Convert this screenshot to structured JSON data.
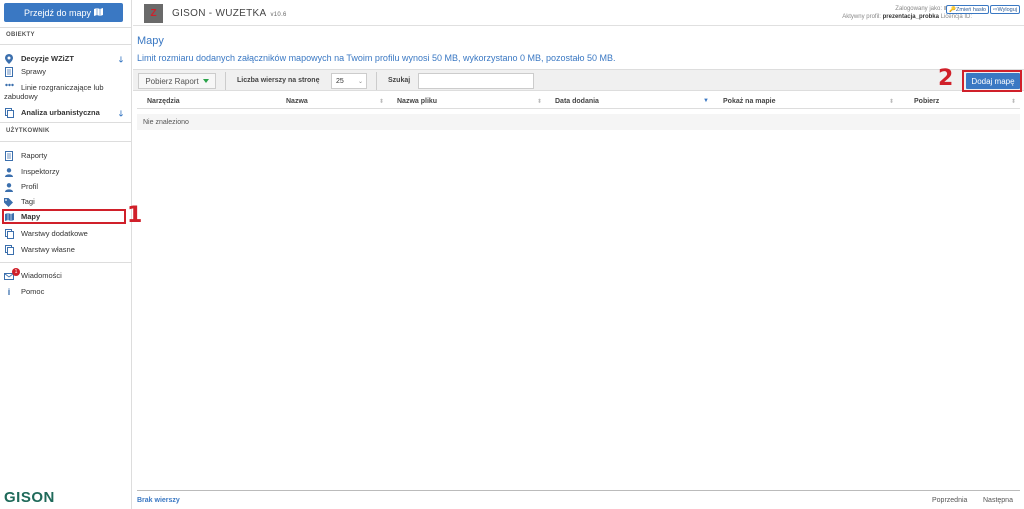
{
  "sidebar": {
    "map_button_label": "Przejdź do mapy",
    "section_objects": "OBIEKTY",
    "section_user": "UŻYTKOWNIK",
    "objects_items": [
      {
        "label": "Decyzje WZiZT",
        "icon": "chevron-down-icon"
      },
      {
        "label": "Sprawy",
        "icon": "document-icon"
      },
      {
        "label": "Linie rozgraniczające lub zabudowy",
        "icon": "dots-icon"
      },
      {
        "label": "Analiza urbanistyczna",
        "icon": "copy-icon"
      }
    ],
    "user_items": [
      {
        "label": "Raporty",
        "icon": "document-icon"
      },
      {
        "label": "Inspektorzy",
        "icon": "user-icon"
      },
      {
        "label": "Profil",
        "icon": "user-icon"
      },
      {
        "label": "Tagi",
        "icon": "tags-icon"
      },
      {
        "label": "Mapy",
        "icon": "map-icon"
      },
      {
        "label": "Warstwy dodatkowe",
        "icon": "layers-icon"
      },
      {
        "label": "Warstwy własne",
        "icon": "layers-icon"
      }
    ],
    "extra_items": [
      {
        "label": "Wiadomości",
        "icon": "mail-icon",
        "badge": "1"
      },
      {
        "label": "Pomoc",
        "icon": "info-icon"
      }
    ],
    "logo_text": "GISON"
  },
  "annotations": {
    "marker_1": "1",
    "marker_2": "2"
  },
  "header": {
    "logo_letter": "Z",
    "app_title": "GISON - WUZETKA",
    "version": "v10.6",
    "logged_in_label": "Zalogowany jako:",
    "active_profile_label": "Aktywny profil:",
    "active_profile": "prezentacja_probka",
    "license_label": "Licencja ID:",
    "change_password": "Zmień hasło",
    "logout": "Wyloguj"
  },
  "main": {
    "page_title": "Mapy",
    "limit_text": "Limit rozmiaru dodanych załączników mapowych na Twoim profilu wynosi 50 MB, wykorzystano 0 MB, pozostało 50 MB.",
    "report_button": "Pobierz Raport",
    "rows_per_page_label": "Liczba wierszy na stronę",
    "rows_per_page_value": "25",
    "search_label": "Szukaj",
    "search_value": "",
    "add_button": "Dodaj mapę",
    "columns": [
      "Narzędzia",
      "Nazwa",
      "Nazwa pliku",
      "Data dodania",
      "Pokaż na mapie",
      "Pobierz"
    ],
    "empty_text": "Nie znaleziono",
    "footer_no_rows": "Brak wierszy",
    "prev_label": "Poprzednia",
    "next_label": "Następna"
  },
  "colors": {
    "accent": "#3a78c3",
    "highlight": "#d0202a",
    "brand_green": "#1f6a5a"
  }
}
